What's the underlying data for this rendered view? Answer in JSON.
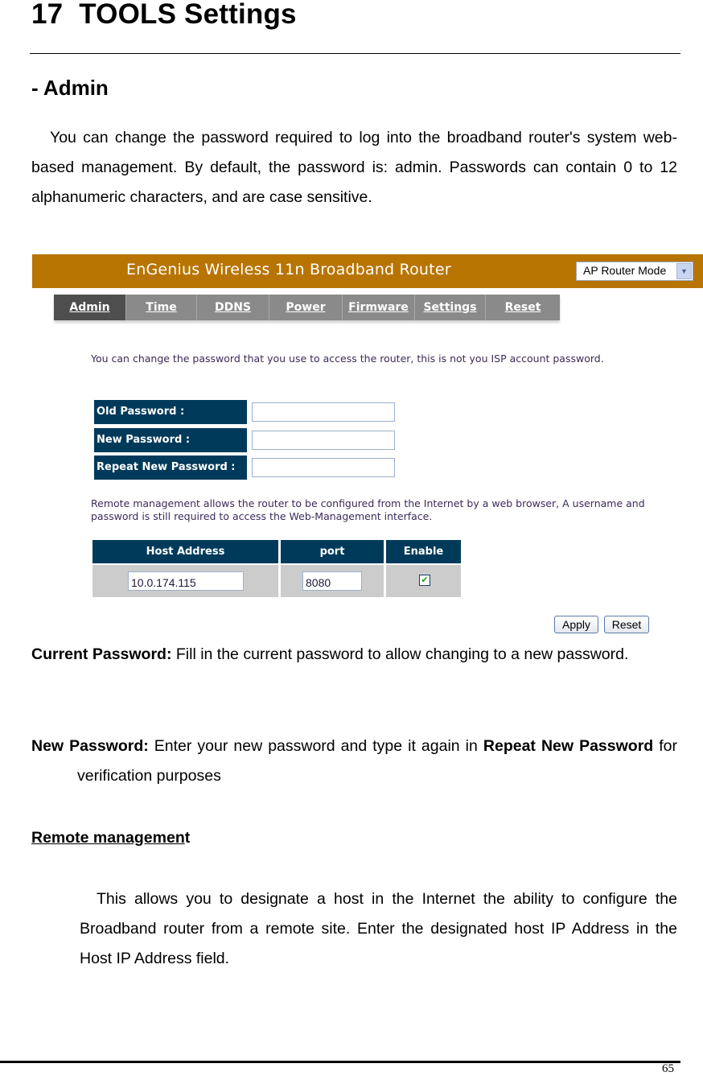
{
  "chapter": {
    "number": "17",
    "title": "TOOLS Settings"
  },
  "section": {
    "title": "- Admin"
  },
  "intro": "You can change the password required to log into the broadband router's system web-based management. By default, the password is: admin. Passwords can contain 0 to 12 alphanumeric characters, and are case sensitive.",
  "router_ui": {
    "header_title": "EnGenius Wireless 11n Broadband Router",
    "header_color": "#b87400",
    "mode_select": {
      "selected": "AP Router Mode",
      "icon": "chevron-down-icon"
    },
    "tabs": [
      {
        "label": "Admin",
        "active": true
      },
      {
        "label": "Time",
        "active": false
      },
      {
        "label": "DDNS",
        "active": false
      },
      {
        "label": "Power",
        "active": false
      },
      {
        "label": "Firmware",
        "active": false
      },
      {
        "label": "Settings",
        "active": false
      },
      {
        "label": "Reset",
        "active": false
      }
    ],
    "password_description": "You can change the password that you use to access the router, this is not you ISP account password.",
    "password_fields": [
      {
        "label": "Old Password :",
        "value": ""
      },
      {
        "label": "New Password :",
        "value": ""
      },
      {
        "label": "Repeat New Password :",
        "value": ""
      }
    ],
    "label_color": "#003a5a",
    "remote_description": "Remote management allows the router to be configured from the Internet by a web browser, A username and password is still required to access the Web-Management interface.",
    "host_table": {
      "headers": [
        "Host Address",
        "port",
        "Enable"
      ],
      "row": {
        "host_address": "10.0.174.115",
        "port": "8080",
        "enabled": true
      }
    },
    "buttons": {
      "apply": "Apply",
      "reset": "Reset"
    }
  },
  "definitions": [
    {
      "term": "Current Password:",
      "text": " Fill in the current password to allow changing to a new password."
    },
    {
      "term": "New Password:",
      "text_before": " Enter your new password and type it again in ",
      "emphasis": "Repeat New Password",
      "text_after": " for verification purposes"
    }
  ],
  "remote_management": {
    "heading_underlined": "Remote managemen",
    "heading_tail": "t",
    "body": "This allows you to designate a host in the Internet the ability to configure the Broadband router from a remote site. Enter the designated host IP Address in the Host IP Address field."
  },
  "page_number": "65"
}
